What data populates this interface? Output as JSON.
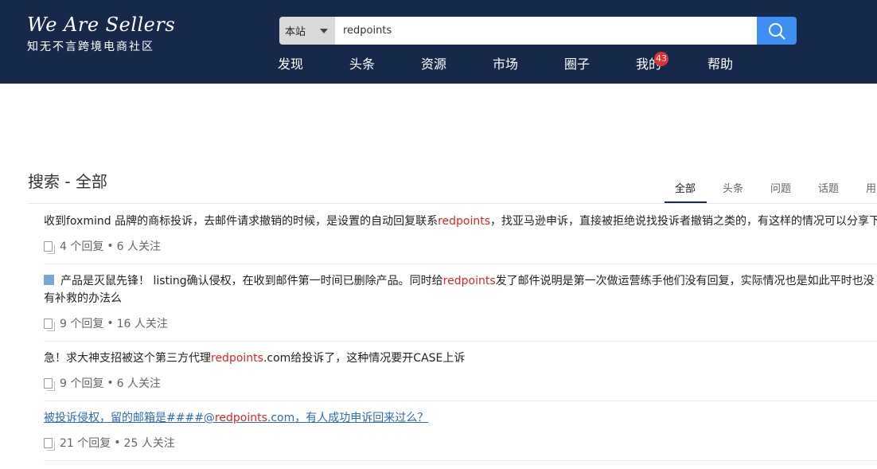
{
  "header": {
    "logo_title": "We Are Sellers",
    "logo_subtitle": "知无不言跨境电商社区",
    "search": {
      "scope": "本站",
      "query": "redpoints"
    },
    "nav": [
      {
        "label": "发现"
      },
      {
        "label": "头条"
      },
      {
        "label": "资源"
      },
      {
        "label": "市场"
      },
      {
        "label": "圈子"
      },
      {
        "label": "我的",
        "badge": "43"
      },
      {
        "label": "帮助"
      }
    ]
  },
  "page": {
    "title": "搜索 - 全部",
    "tabs": [
      "全部",
      "头条",
      "问题",
      "话题",
      "用"
    ],
    "active_tab": "全部"
  },
  "results": [
    {
      "title_pre": "收到foxmind 品牌的商标投诉，去邮件请求撤销的时候，是设置的自动回复联系",
      "keyword": "redpoints",
      "title_post": "，找亚马逊申诉，直接被拒绝说找投诉者撤销之类的，有这样的情况可以分享下",
      "replies": "4 个回复",
      "followers": "6 人关注"
    },
    {
      "title_pre": "产品是灭鼠先锋！ listing确认侵权，在收到邮件第一时间已删除产品。同时给",
      "keyword": "redpoints",
      "title_post": "发了邮件说明是第一次做运营练手他们没有回复，实际情况也是如此平时也没有补救的办法么",
      "replies": "9 个回复",
      "followers": "16 人关注"
    },
    {
      "title_pre": "急！求大神支招被这个第三方代理",
      "keyword": "redpoints",
      "title_post": ".com给投诉了，这种情况要开CASE上诉",
      "replies": "9 个回复",
      "followers": "6 人关注"
    },
    {
      "title_pre": "被投诉侵权，留的邮箱是####@",
      "keyword": "redpoints",
      "title_post": ".com，有人成功申诉回来过么？",
      "replies": "21 个回复",
      "followers": "25 人关注"
    }
  ],
  "colors": {
    "header_bg": "#17294b",
    "search_button": "#3d8ff3",
    "highlight": "#e02424",
    "badge": "#e62e2e",
    "link": "#2c6bb1"
  }
}
